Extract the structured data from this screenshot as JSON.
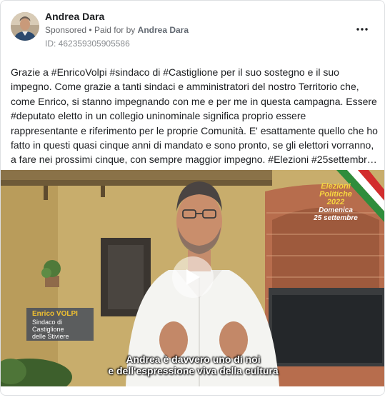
{
  "post": {
    "author": "Andrea Dara",
    "sponsored_label": "Sponsored",
    "separator": "•",
    "paid_for_prefix": "Paid for by",
    "paid_for_name": "Andrea Dara",
    "ad_id": "ID: 462359305905586",
    "more_icon": "more-horizontal-icon",
    "body_lines": [
      "Grazie a #EnricoVolpi #sindaco di #Castiglione per il suo sostegno e il suo",
      "impegno. Come grazie a tanti sindaci e amministratori del nostro Territorio che,",
      "come Enrico, si stanno impegnando con me e per me in questa campagna. Essere",
      "#deputato eletto in un collegio uninominale significa proprio essere",
      "rappresentante e riferimento per le proprie Comunità. E' esattamente quello che ho",
      "fatto in questi quasi cinque anni di mandato e sono pronto, se gli elettori vorranno,",
      "a fare nei prossimi cinque, con sempre maggior impegno. #Elezioni #25settembr…"
    ]
  },
  "video": {
    "play_icon": "play-icon",
    "badge": {
      "line1": "Elezioni",
      "line2": "Politiche",
      "line3": "2022",
      "line4": "Domenica",
      "line5": "25 settembre"
    },
    "lower_third": {
      "name": "Enrico VOLPI",
      "role_line1": "Sindaco di",
      "role_line2": "Castiglione",
      "role_line3": "delle Stiviere"
    },
    "subtitle_line1": "Andrea è davvero uno di noi",
    "subtitle_line2": "e dell'espressione viva della cultura"
  },
  "colors": {
    "badge_yellow": "#f7d640",
    "lower_third_name": "#f2c230",
    "meta_grey": "#65676b"
  }
}
